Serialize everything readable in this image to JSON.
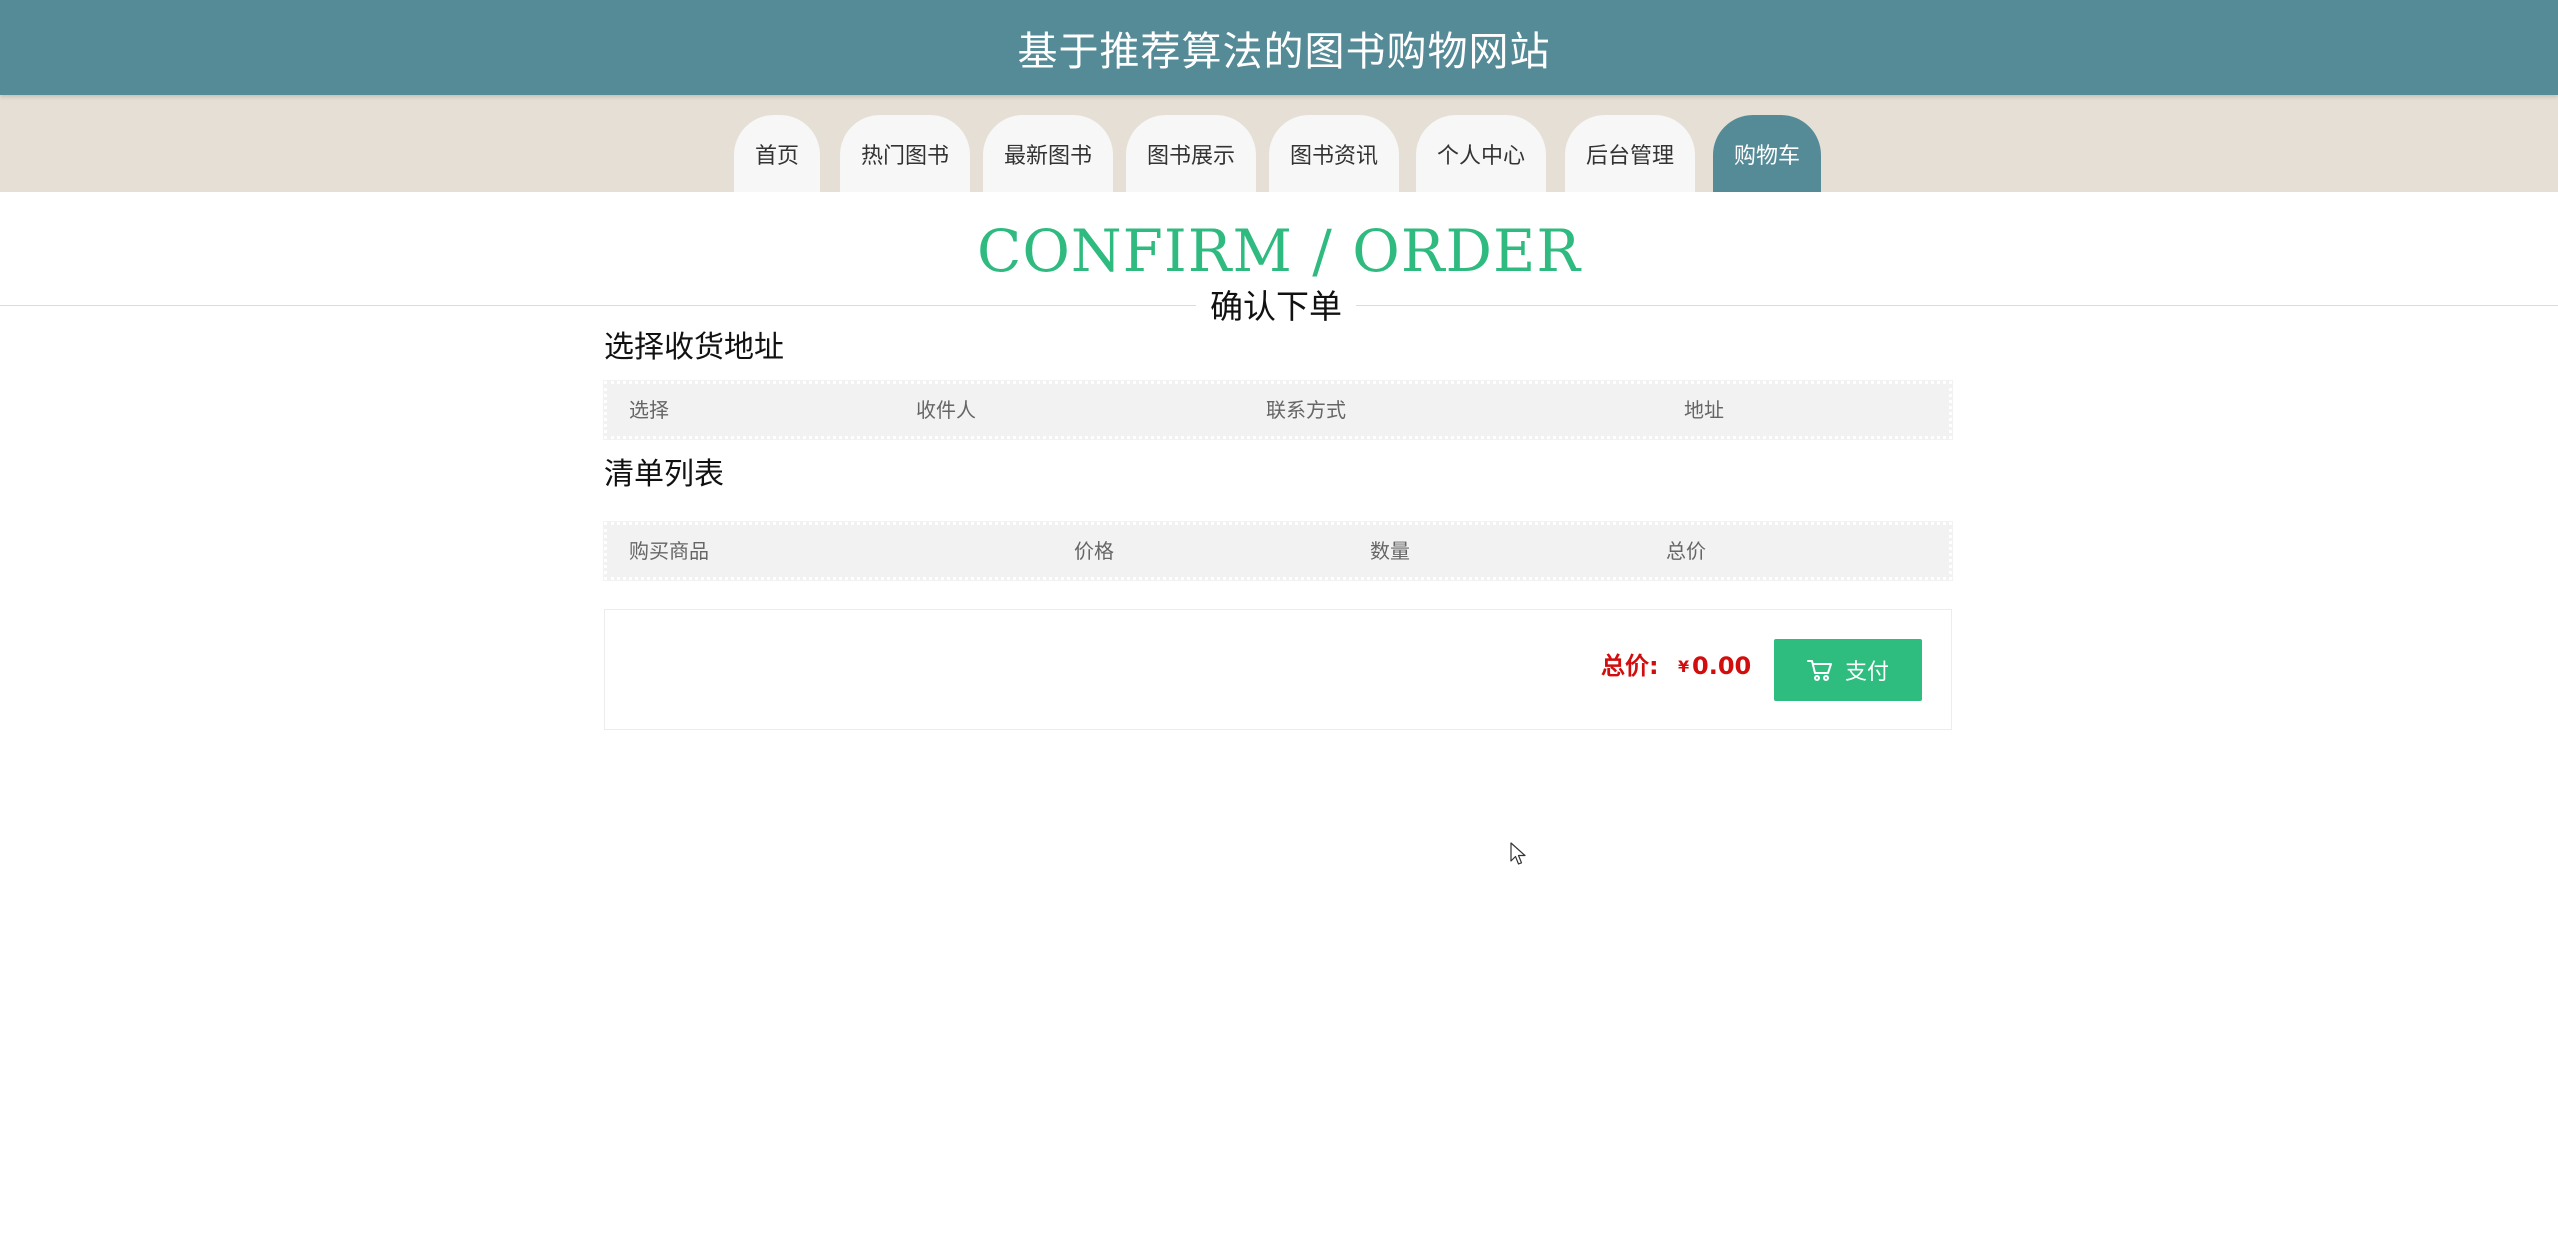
{
  "header": {
    "title": "基于推荐算法的图书购物网站"
  },
  "nav": {
    "items": [
      {
        "label": "首页"
      },
      {
        "label": "热门图书"
      },
      {
        "label": "最新图书"
      },
      {
        "label": "图书展示"
      },
      {
        "label": "图书资讯"
      },
      {
        "label": "个人中心"
      },
      {
        "label": "后台管理"
      },
      {
        "label": "购物车",
        "active": true
      }
    ]
  },
  "hero": {
    "title_en": "CONFIRM / ORDER",
    "title_cn": "确认下单"
  },
  "address_section": {
    "title": "选择收货地址",
    "columns": [
      "选择",
      "收件人",
      "联系方式",
      "地址"
    ],
    "rows": []
  },
  "order_section": {
    "title": "清单列表",
    "columns": [
      "购买商品",
      "价格",
      "数量",
      "总价"
    ],
    "rows": []
  },
  "summary": {
    "total_label": "总价:",
    "currency": "¥",
    "total_amount": "0.00",
    "pay_label": "支付",
    "pay_icon": "cart-icon"
  },
  "colors": {
    "header_bg": "#558a97",
    "nav_bg": "#e6dfd5",
    "accent_green": "#2ebd7f",
    "price_red": "#d10d0d"
  }
}
